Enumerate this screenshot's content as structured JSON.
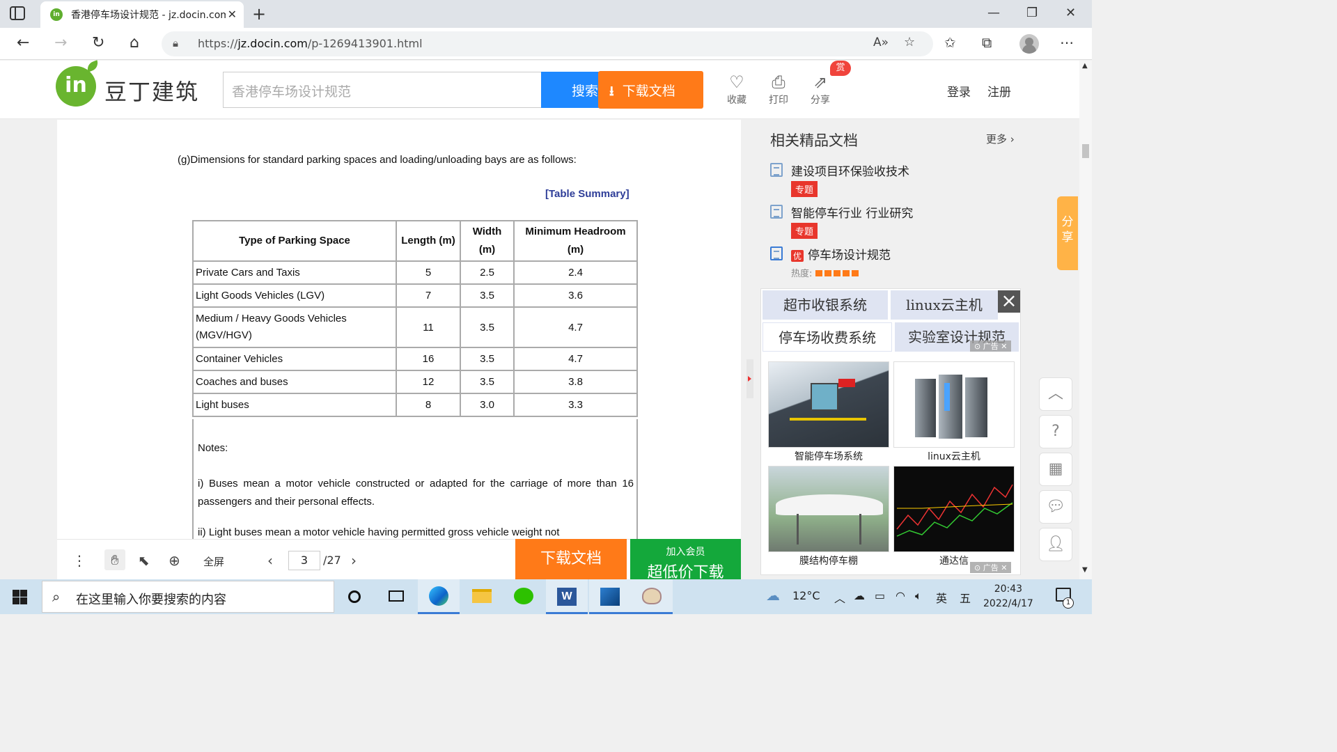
{
  "browser": {
    "tab_title": "香港停车场设计规范 - jz.docin.com",
    "url_prefix": "https://",
    "url_host": "jz.docin.com",
    "url_path": "/p-1269413901.html",
    "icons": [
      "tab-panel-icon",
      "close-icon",
      "new-tab-icon",
      "minimize-icon",
      "maximize-icon",
      "close-window-icon",
      "back-icon",
      "forward-icon",
      "refresh-icon",
      "home-icon",
      "lock-icon",
      "read-aloud-icon",
      "add-favorite-icon",
      "favorites-icon",
      "collections-icon",
      "profile-icon",
      "more-icon"
    ]
  },
  "site": {
    "logo_mark": "in",
    "logo_text": "豆丁建筑",
    "search_placeholder": "香港停车场设计规范",
    "search_button": "搜索",
    "download_button": "下载文档",
    "tools": [
      {
        "label": "收藏",
        "icon": "heart-icon"
      },
      {
        "label": "打印",
        "icon": "print-icon"
      },
      {
        "label": "分享",
        "icon": "share-icon"
      }
    ],
    "reward_badge": "赏",
    "login": "登录",
    "register": "注册"
  },
  "document": {
    "intro": "(g)Dimensions for standard parking spaces and loading/unloading bays are as follows:",
    "table_summary": "[Table Summary]",
    "table_headers": [
      "Type of Parking Space",
      "Length (m)",
      "Width (m)",
      "Minimum Headroom (m)"
    ],
    "rows": [
      [
        "Private Cars and Taxis",
        "5",
        "2.5",
        "2.4"
      ],
      [
        "Light Goods Vehicles (LGV)",
        "7",
        "3.5",
        "3.6"
      ],
      [
        "Medium / Heavy Goods Vehicles (MGV/HGV)",
        "11",
        "3.5",
        "4.7"
      ],
      [
        "Container Vehicles",
        "16",
        "3.5",
        "4.7"
      ],
      [
        "Coaches and buses",
        "12",
        "3.5",
        "3.8"
      ],
      [
        "Light buses",
        "8",
        "3.0",
        "3.3"
      ]
    ],
    "notes_title": "Notes:",
    "note_1": "i)  Buses mean a motor vehicle constructed or adapted for the carriage of more than 16 passengers and their personal effects.",
    "note_2": "ii) Light buses mean a motor vehicle having permitted gross vehicle weight not"
  },
  "viewer": {
    "fullscreen": "全屏",
    "current_page": "3",
    "total_pages": "/27",
    "download": "下载文档",
    "member_small": "加入会员",
    "member_big": "超低价下载"
  },
  "sidebar": {
    "title": "相关精品文档",
    "more": "更多",
    "items": [
      {
        "text": "建设项目环保验收技术",
        "tag": "专题"
      },
      {
        "text": "智能停车行业 行业研究",
        "tag": "专题"
      },
      {
        "badge": "优",
        "text": "停车场设计规范"
      }
    ],
    "hotness_label": "热度:",
    "hotness_level": 5,
    "ad_keywords": [
      "超市收银系统",
      "linux云主机",
      "停车场收费系统",
      "实验室设计规范"
    ],
    "ad_cards": [
      "智能停车场系统",
      "linux云主机",
      "膜结构停车棚",
      "通达信"
    ],
    "ad_mark": "广告",
    "share_float": "分享"
  },
  "taskbar": {
    "search_placeholder": "在这里输入你要搜索的内容",
    "weather": "12°C",
    "ime_lang": "英",
    "ime_mode": "五",
    "time": "20:43",
    "date": "2022/4/17",
    "notifications": "1"
  }
}
